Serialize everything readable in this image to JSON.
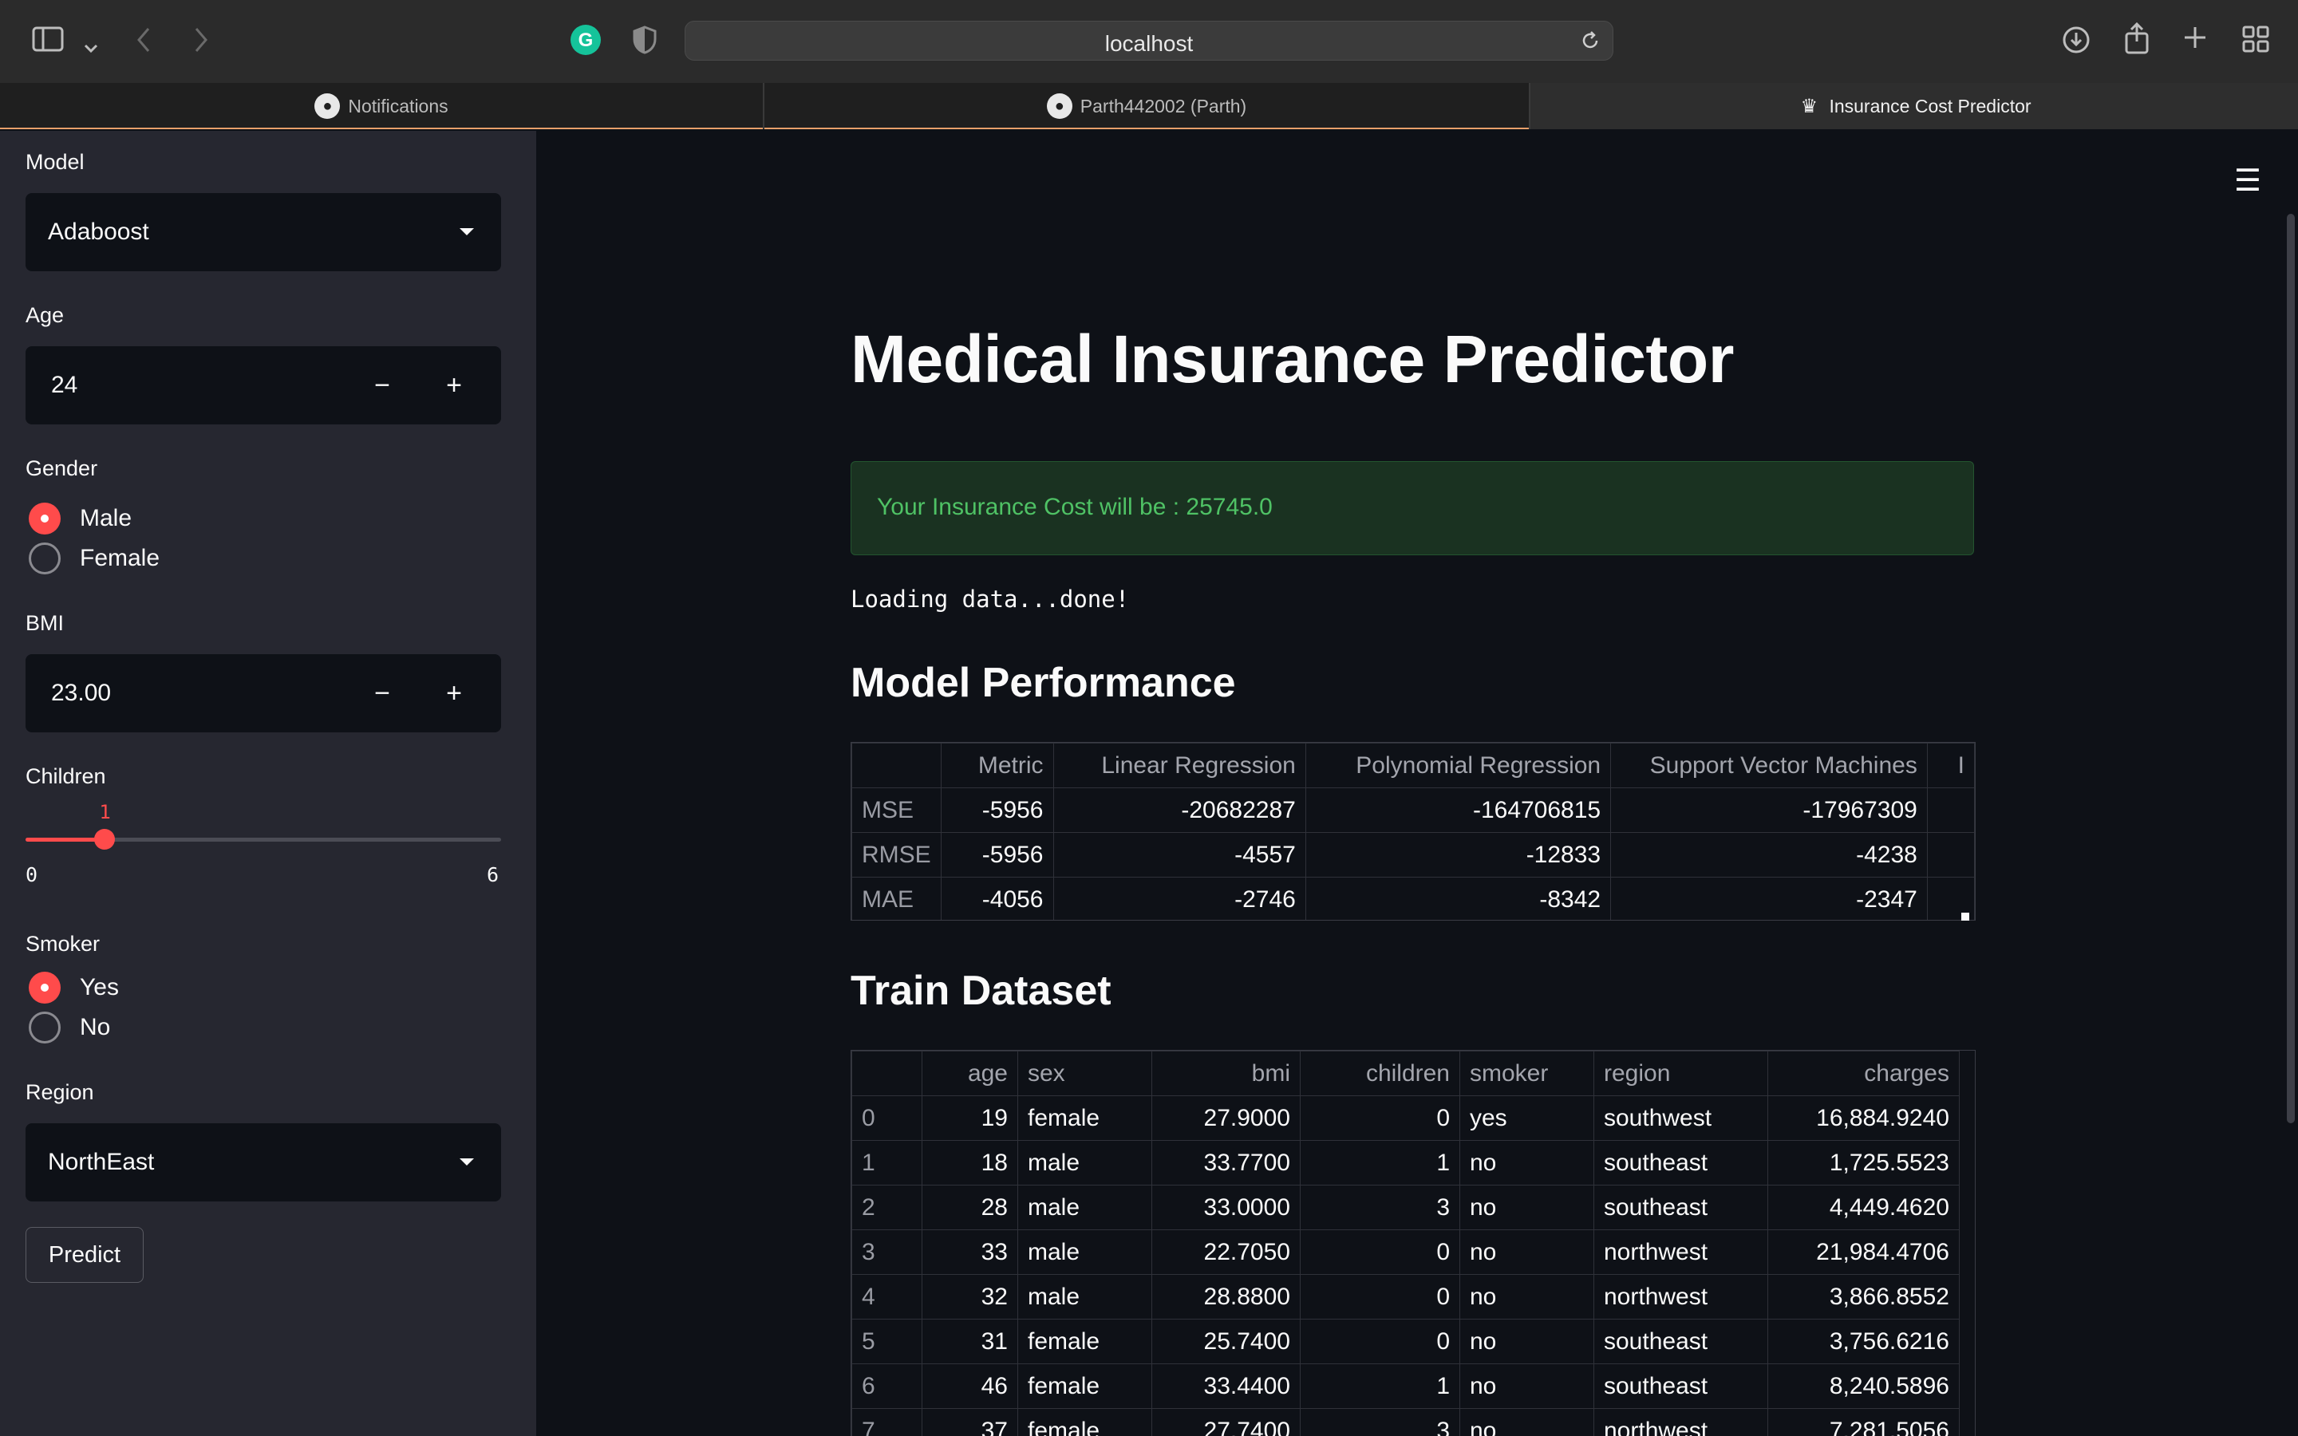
{
  "browser": {
    "url": "localhost",
    "tabs": [
      {
        "label": "Notifications",
        "icon": "github-icon",
        "active": false
      },
      {
        "label": "Parth442002 (Parth)",
        "icon": "github-icon",
        "active": false
      },
      {
        "label": "Insurance Cost Predictor",
        "icon": "streamlit-crown-icon",
        "active": true
      }
    ]
  },
  "sidebar": {
    "model": {
      "label": "Model",
      "value": "Adaboost"
    },
    "age": {
      "label": "Age",
      "value": "24"
    },
    "gender": {
      "label": "Gender",
      "options": [
        "Male",
        "Female"
      ],
      "selected": "Male"
    },
    "bmi": {
      "label": "BMI",
      "value": "23.00"
    },
    "children": {
      "label": "Children",
      "value": "1",
      "min": "0",
      "max": "6",
      "fraction": 0.1667
    },
    "smoker": {
      "label": "Smoker",
      "options": [
        "Yes",
        "No"
      ],
      "selected": "Yes"
    },
    "region": {
      "label": "Region",
      "value": "NorthEast"
    },
    "predict_label": "Predict",
    "minus": "−",
    "plus": "+"
  },
  "main": {
    "title": "Medical Insurance Predictor",
    "result": "Your Insurance Cost will be : 25745.0",
    "loading": "Loading data...done!",
    "performance": {
      "heading": "Model Performance",
      "columns": [
        "",
        "Metric",
        "Linear Regression",
        "Polynomial Regression",
        "Support Vector Machines",
        "I"
      ],
      "rows": [
        [
          "MSE",
          "-5956",
          "-20682287",
          "-164706815",
          "-17967309",
          ""
        ],
        [
          "RMSE",
          "-5956",
          "-4557",
          "-12833",
          "-4238",
          ""
        ],
        [
          "MAE",
          "-4056",
          "-2746",
          "-8342",
          "-2347",
          ""
        ]
      ]
    },
    "train": {
      "heading": "Train Dataset",
      "columns": [
        "",
        "age",
        "sex",
        "bmi",
        "children",
        "smoker",
        "region",
        "charges"
      ],
      "rows": [
        [
          "0",
          "19",
          "female",
          "27.9000",
          "0",
          "yes",
          "southwest",
          "16,884.9240"
        ],
        [
          "1",
          "18",
          "male",
          "33.7700",
          "1",
          "no",
          "southeast",
          "1,725.5523"
        ],
        [
          "2",
          "28",
          "male",
          "33.0000",
          "3",
          "no",
          "southeast",
          "4,449.4620"
        ],
        [
          "3",
          "33",
          "male",
          "22.7050",
          "0",
          "no",
          "northwest",
          "21,984.4706"
        ],
        [
          "4",
          "32",
          "male",
          "28.8800",
          "0",
          "no",
          "northwest",
          "3,866.8552"
        ],
        [
          "5",
          "31",
          "female",
          "25.7400",
          "0",
          "no",
          "southeast",
          "3,756.6216"
        ],
        [
          "6",
          "46",
          "female",
          "33.4400",
          "1",
          "no",
          "southeast",
          "8,240.5896"
        ],
        [
          "7",
          "37",
          "female",
          "27.7400",
          "3",
          "no",
          "northwest",
          "7,281.5056"
        ]
      ]
    }
  },
  "colors": {
    "accent": "#ff4b4b",
    "success_text": "#4fc265",
    "background": "#0e1117",
    "sidebar": "#262730"
  }
}
